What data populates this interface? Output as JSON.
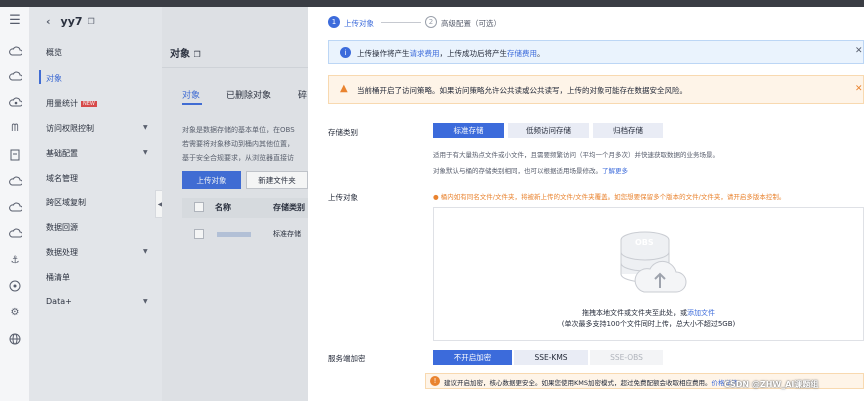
{
  "nav": {
    "title": "yy7",
    "items": [
      {
        "label": "概览"
      },
      {
        "label": "对象",
        "active": true
      },
      {
        "label": "用量统计",
        "badge": "NEW"
      },
      {
        "label": "访问权限控制",
        "expandable": true
      },
      {
        "label": "基础配置",
        "expandable": true
      },
      {
        "label": "域名管理"
      },
      {
        "label": "跨区域复制"
      },
      {
        "label": "数据回源"
      },
      {
        "label": "数据处理",
        "expandable": true
      },
      {
        "label": "桶清单"
      },
      {
        "label": "Data+",
        "expandable": true
      }
    ]
  },
  "main": {
    "title": "对象",
    "tabs": [
      "对象",
      "已删除对象",
      "碎"
    ],
    "desc": [
      "对象是数据存储的基本单位，在OBS",
      "若需要将对象移动到桶内其他位置，",
      "基于安全合规要求，从浏览器直接访"
    ],
    "upload_button": "上传对象",
    "new_folder_button": "新建文件夹",
    "table_headers": [
      "名称",
      "存储类别"
    ],
    "row_class": "标准存储"
  },
  "panel": {
    "steps": [
      {
        "num": "1",
        "label": "上传对象"
      },
      {
        "num": "2",
        "label": "高级配置（可选）"
      }
    ],
    "info_text_a": "上传操作将产生",
    "info_link_a": "请求费用",
    "info_text_b": "，上传成功后将产生",
    "info_link_b": "存储费用",
    "info_text_c": "。",
    "warn_text": "当前桶开启了访问策略。如果访问策略允许公共读或公共读写，上传的对象可能存在数据安全风险。",
    "storage_label": "存储类别",
    "storage_options": [
      "标准存储",
      "低频访问存储",
      "归档存储"
    ],
    "storage_desc1": "适用于有大量热点文件或小文件，且需要频繁访问（平均一个月多次）并快速获取数据的业务场景。",
    "storage_desc2": "对象默认与桶的存储类别相同，也可以根据适用场景修改。",
    "storage_more": "了解更多",
    "upload_label": "上传对象",
    "upload_warn": "桶内如有同名文件/文件夹，将被新上传的文件/文件夹覆盖。如您想要保留多个版本的文件/文件夹，请开启多版本控制。",
    "obs_text": "OBS",
    "drop_text_a": "拖拽本地文件或文件夹至此处，或",
    "drop_link": "添加文件",
    "drop_sub": "(单次最多支持100个文件同时上传，总大小不超过5GB)",
    "enc_label": "服务端加密",
    "enc_options": [
      "不开启加密",
      "SSE-KMS",
      "SSE-OBS"
    ],
    "enc_warn": "建议开启加密，核心数据更安全。如果您使用KMS加密模式，超过免费配额会收取相应费用。",
    "enc_more": "价格详情"
  },
  "watermark": "CSDN @ZHW_AI课题组"
}
